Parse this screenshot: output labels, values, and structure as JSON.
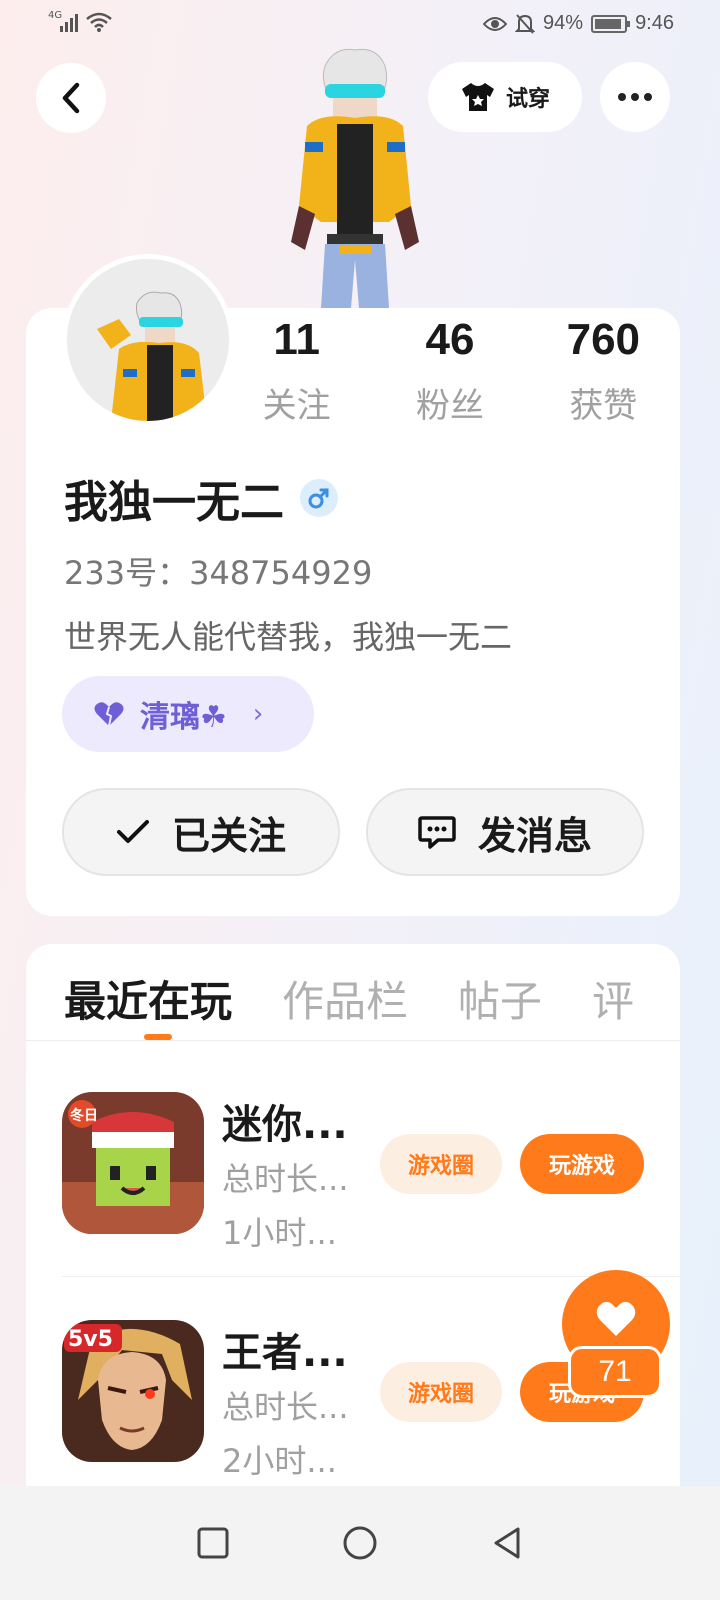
{
  "status_bar": {
    "network": "4G",
    "battery": "94%",
    "battery_level": 0.94,
    "time": "9:46"
  },
  "header": {
    "back_icon": "back-chevron-icon",
    "tryon_label": "试穿",
    "more_icon": "more-dots-icon"
  },
  "profile": {
    "stats": [
      {
        "value": "11",
        "label": "关注"
      },
      {
        "value": "46",
        "label": "粉丝"
      },
      {
        "value": "760",
        "label": "获赞"
      }
    ],
    "username": "我独一无二",
    "gender_icon": "male-icon",
    "uid": "233号：348754929",
    "bio": "世界无人能代替我，我独一无二",
    "tag_label": "清璃☘",
    "follow_label": "已关注",
    "message_label": "发消息"
  },
  "content": {
    "tabs": [
      "最近在玩",
      "作品栏",
      "帖子",
      "评"
    ],
    "active_tab": 0,
    "games": [
      {
        "name": "迷你...",
        "meta1": "总时长...",
        "meta2": "1小时...",
        "icon_badge": "冬日",
        "circle_label": "游戏圈",
        "play_label": "玩游戏"
      },
      {
        "name": "王者...",
        "meta1": "总时长...",
        "meta2": "2小时...",
        "icon_badge": "5v5",
        "circle_label": "游戏圈",
        "play_label": "玩游戏"
      }
    ]
  },
  "like": {
    "count": "71",
    "icon": "heart-icon"
  },
  "colors": {
    "accent": "#ff7a1a",
    "tag_purple": "#6e5fd6",
    "male_blue": "#3a8ee6"
  }
}
